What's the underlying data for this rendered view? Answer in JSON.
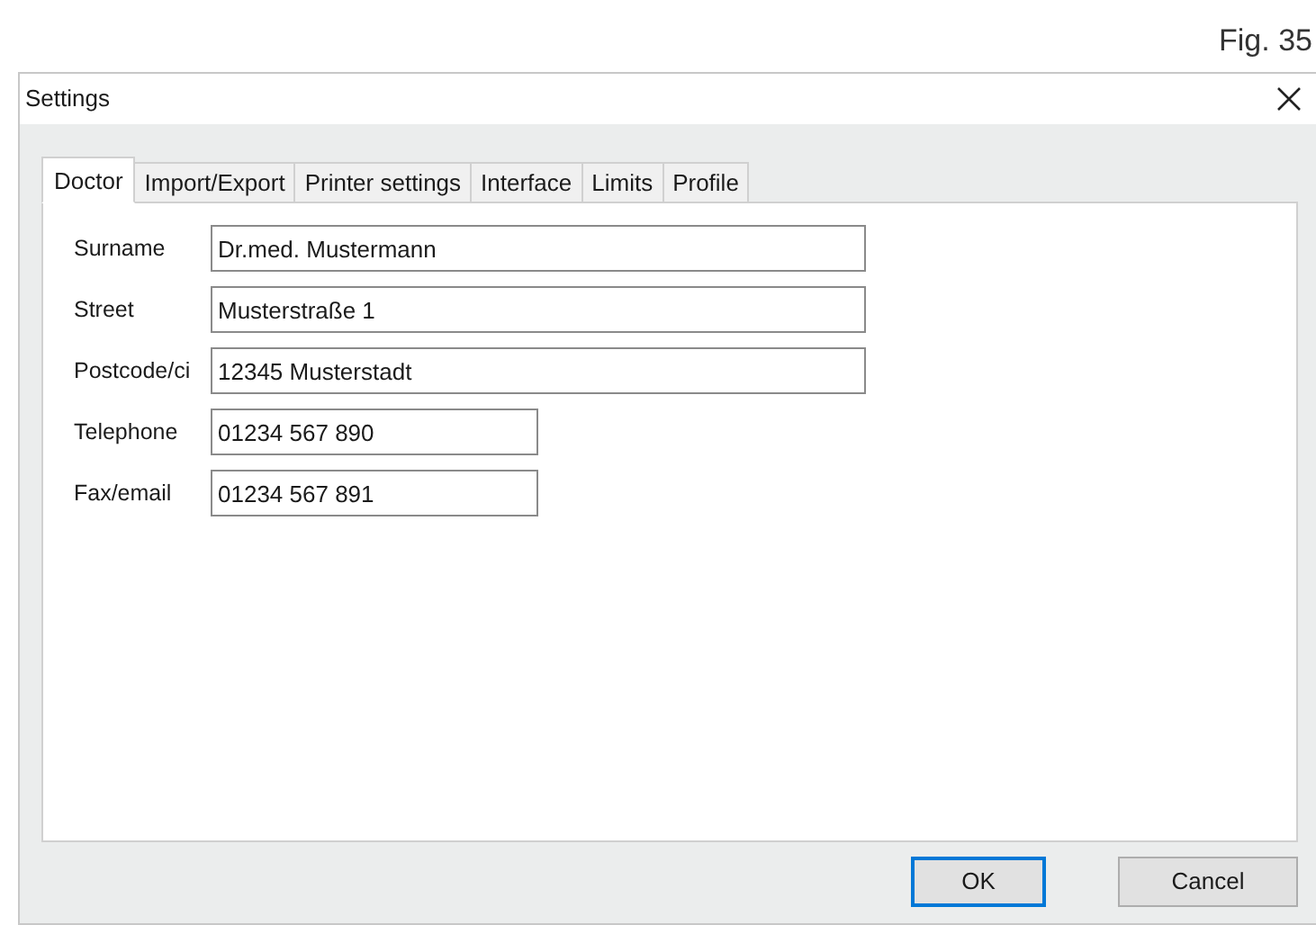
{
  "figure_label": "Fig. 35",
  "window": {
    "title": "Settings"
  },
  "tabs": [
    {
      "label": "Doctor",
      "selected": true
    },
    {
      "label": "Import/Export",
      "selected": false
    },
    {
      "label": "Printer settings",
      "selected": false
    },
    {
      "label": "Interface",
      "selected": false
    },
    {
      "label": "Limits",
      "selected": false
    },
    {
      "label": "Profile",
      "selected": false
    }
  ],
  "fields": [
    {
      "label": "Surname",
      "value": "Dr.med. Mustermann",
      "kind": "wide"
    },
    {
      "label": "Street",
      "value": "Musterstraße 1",
      "kind": "wide"
    },
    {
      "label": "Postcode/ci",
      "value": "12345 Musterstadt",
      "kind": "wide"
    },
    {
      "label": "Telephone",
      "value": "01234 567 890",
      "kind": "narrow"
    },
    {
      "label": "Fax/email",
      "value": "01234 567 891",
      "kind": "narrow"
    }
  ],
  "buttons": [
    {
      "label": "OK",
      "default": true
    },
    {
      "label": "Cancel",
      "default": false
    }
  ]
}
